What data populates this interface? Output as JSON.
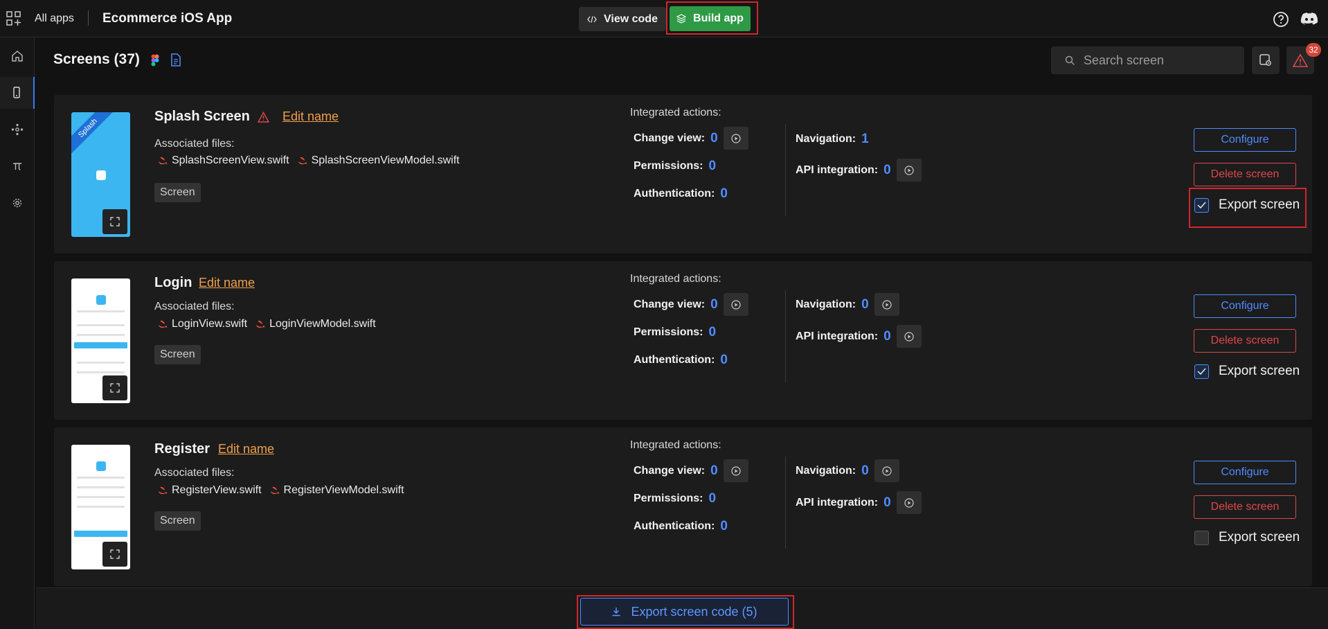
{
  "topbar": {
    "all_apps": "All apps",
    "app_title": "Ecommerce iOS App",
    "view_code": "View code",
    "build_app": "Build app"
  },
  "sidebar": {
    "items": [
      {
        "icon": "home-icon"
      },
      {
        "icon": "phone-icon",
        "active": true
      },
      {
        "icon": "components-icon"
      },
      {
        "icon": "pi-icon"
      },
      {
        "icon": "gear-icon"
      }
    ]
  },
  "header": {
    "title": "Screens (37)",
    "search_placeholder": "Search screen",
    "alert_count": "32"
  },
  "labels": {
    "associated_files": "Associated files:",
    "integrated_actions": "Integrated actions:",
    "edit_name": "Edit name",
    "change_view": "Change view:",
    "permissions": "Permissions:",
    "authentication": "Authentication:",
    "navigation": "Navigation:",
    "api_integration": "API integration:",
    "configure": "Configure",
    "delete_screen": "Delete screen",
    "export_screen": "Export screen"
  },
  "screens": [
    {
      "name": "Splash Screen",
      "warning": true,
      "ribbon": "Splash",
      "files": [
        "SplashScreenView.swift",
        "SplashScreenViewModel.swift"
      ],
      "tag": "Screen",
      "change_view": "0",
      "permissions": "0",
      "authentication": "0",
      "navigation": "1",
      "api_integration": "0",
      "export_checked": true
    },
    {
      "name": "Login",
      "warning": false,
      "files": [
        "LoginView.swift",
        "LoginViewModel.swift"
      ],
      "tag": "Screen",
      "change_view": "0",
      "permissions": "0",
      "authentication": "0",
      "navigation": "0",
      "api_integration": "0",
      "export_checked": true
    },
    {
      "name": "Register",
      "warning": false,
      "files": [
        "RegisterView.swift",
        "RegisterViewModel.swift"
      ],
      "tag": "Screen",
      "change_view": "0",
      "permissions": "0",
      "authentication": "0",
      "navigation": "0",
      "api_integration": "0",
      "export_checked": false
    }
  ],
  "footer": {
    "export_code": "Export screen code (5)"
  },
  "colors": {
    "accent": "#4f8cff",
    "build": "#2e9a45",
    "danger": "#e0474c",
    "link": "#f0a04b",
    "highlight": "#d1262c"
  }
}
